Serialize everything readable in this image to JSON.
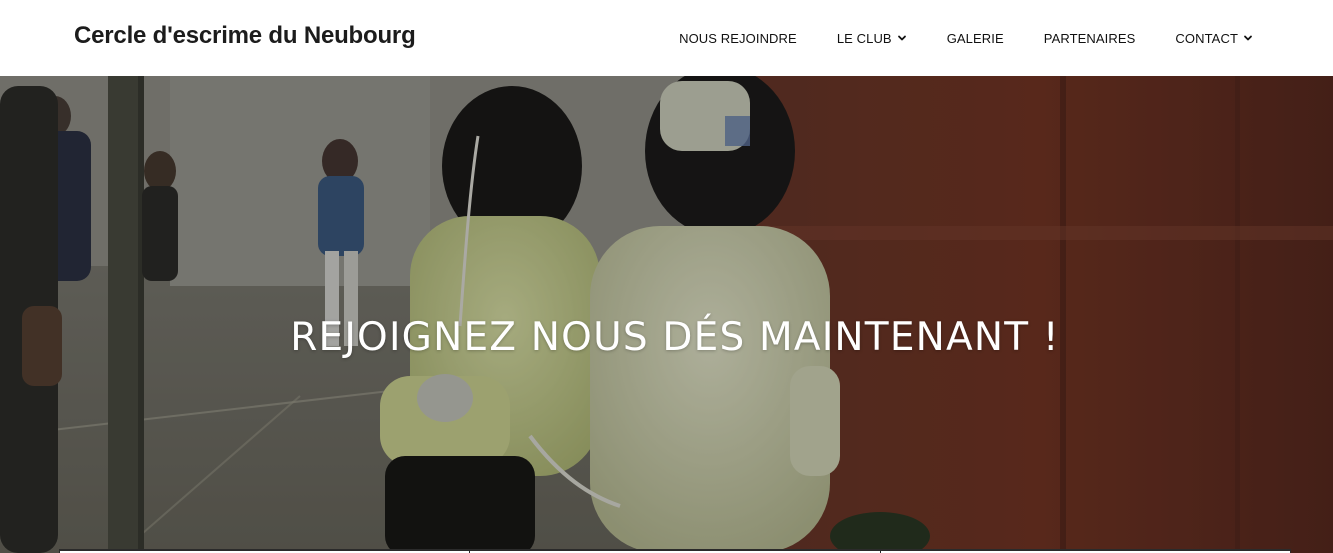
{
  "site": {
    "title": "Cercle d'escrime du Neubourg"
  },
  "nav": {
    "items": [
      {
        "label": "NOUS REJOINDRE",
        "has_dropdown": false
      },
      {
        "label": "LE CLUB",
        "has_dropdown": true
      },
      {
        "label": "GALERIE",
        "has_dropdown": false
      },
      {
        "label": "PARTENAIRES",
        "has_dropdown": false
      },
      {
        "label": "CONTACT",
        "has_dropdown": true
      }
    ]
  },
  "hero": {
    "heading": "REJOIGNEZ NOUS DÉS MAINTENANT !",
    "image_description": "young fencers in white jackets and masks in a gym"
  },
  "colors": {
    "header_bg": "#ffffff",
    "title_text": "#1c1c1c",
    "nav_text": "#111111",
    "hero_text": "#ffffff"
  },
  "icons": {
    "dropdown": "chevron-down-icon"
  }
}
